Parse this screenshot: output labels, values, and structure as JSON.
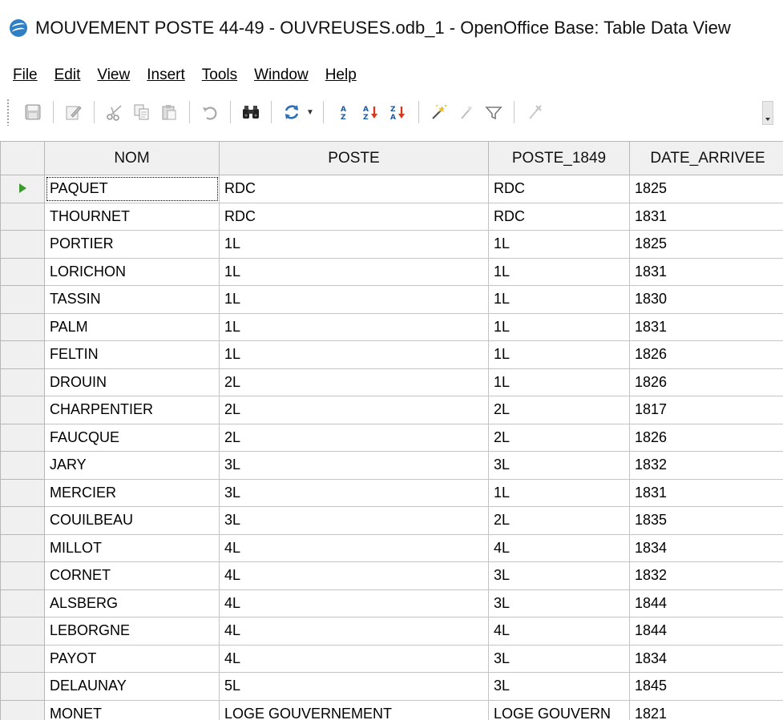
{
  "window": {
    "title": "MOUVEMENT POSTE 44-49 - OUVREUSES.odb_1 - OpenOffice Base: Table Data View",
    "icon": "openoffice-logo-icon"
  },
  "menu": [
    {
      "label": "File"
    },
    {
      "label": "Edit"
    },
    {
      "label": "View"
    },
    {
      "label": "Insert"
    },
    {
      "label": "Tools"
    },
    {
      "label": "Window"
    },
    {
      "label": "Help"
    }
  ],
  "toolbar": {
    "icons": [
      "save-icon",
      "edit-icon",
      "cut-icon",
      "copy-icon",
      "paste-icon",
      "undo-icon",
      "find-icon",
      "refresh-icon",
      "sort-icon",
      "sort-ascending-icon",
      "sort-descending-icon",
      "autofilter-icon",
      "standard-filter-icon",
      "apply-filter-icon",
      "remove-filter-icon"
    ]
  },
  "table": {
    "columns": [
      "NOM",
      "POSTE",
      "POSTE_1849",
      "DATE_ARRIVEE"
    ],
    "rows": [
      [
        "PAQUET",
        "RDC",
        "RDC",
        "1825"
      ],
      [
        "THOURNET",
        "RDC",
        "RDC",
        "1831"
      ],
      [
        "PORTIER",
        "1L",
        "1L",
        "1825"
      ],
      [
        "LORICHON",
        "1L",
        "1L",
        "1831"
      ],
      [
        "TASSIN",
        "1L",
        "1L",
        "1830"
      ],
      [
        "PALM",
        "1L",
        "1L",
        "1831"
      ],
      [
        "FELTIN",
        "1L",
        "1L",
        "1826"
      ],
      [
        "DROUIN",
        "2L",
        "1L",
        "1826"
      ],
      [
        "CHARPENTIER",
        "2L",
        "2L",
        "1817"
      ],
      [
        "FAUCQUE",
        "2L",
        "2L",
        "1826"
      ],
      [
        "JARY",
        "3L",
        "3L",
        "1832"
      ],
      [
        "MERCIER",
        "3L",
        "1L",
        "1831"
      ],
      [
        "COUILBEAU",
        "3L",
        "2L",
        "1835"
      ],
      [
        "MILLOT",
        "4L",
        "4L",
        "1834"
      ],
      [
        "CORNET",
        "4L",
        "3L",
        "1832"
      ],
      [
        "ALSBERG",
        "4L",
        "3L",
        "1844"
      ],
      [
        "LEBORGNE",
        "4L",
        "4L",
        "1844"
      ],
      [
        "PAYOT",
        "4L",
        "3L",
        "1834"
      ],
      [
        "DELAUNAY",
        "5L",
        "3L",
        "1845"
      ],
      [
        "MONET",
        "LOGE GOUVERNEMENT",
        "LOGE GOUVERN",
        "1821"
      ]
    ],
    "current_row": 0,
    "colors": {
      "cursor": "#3a9a2c",
      "header_bg": "#f0f0f0"
    }
  }
}
